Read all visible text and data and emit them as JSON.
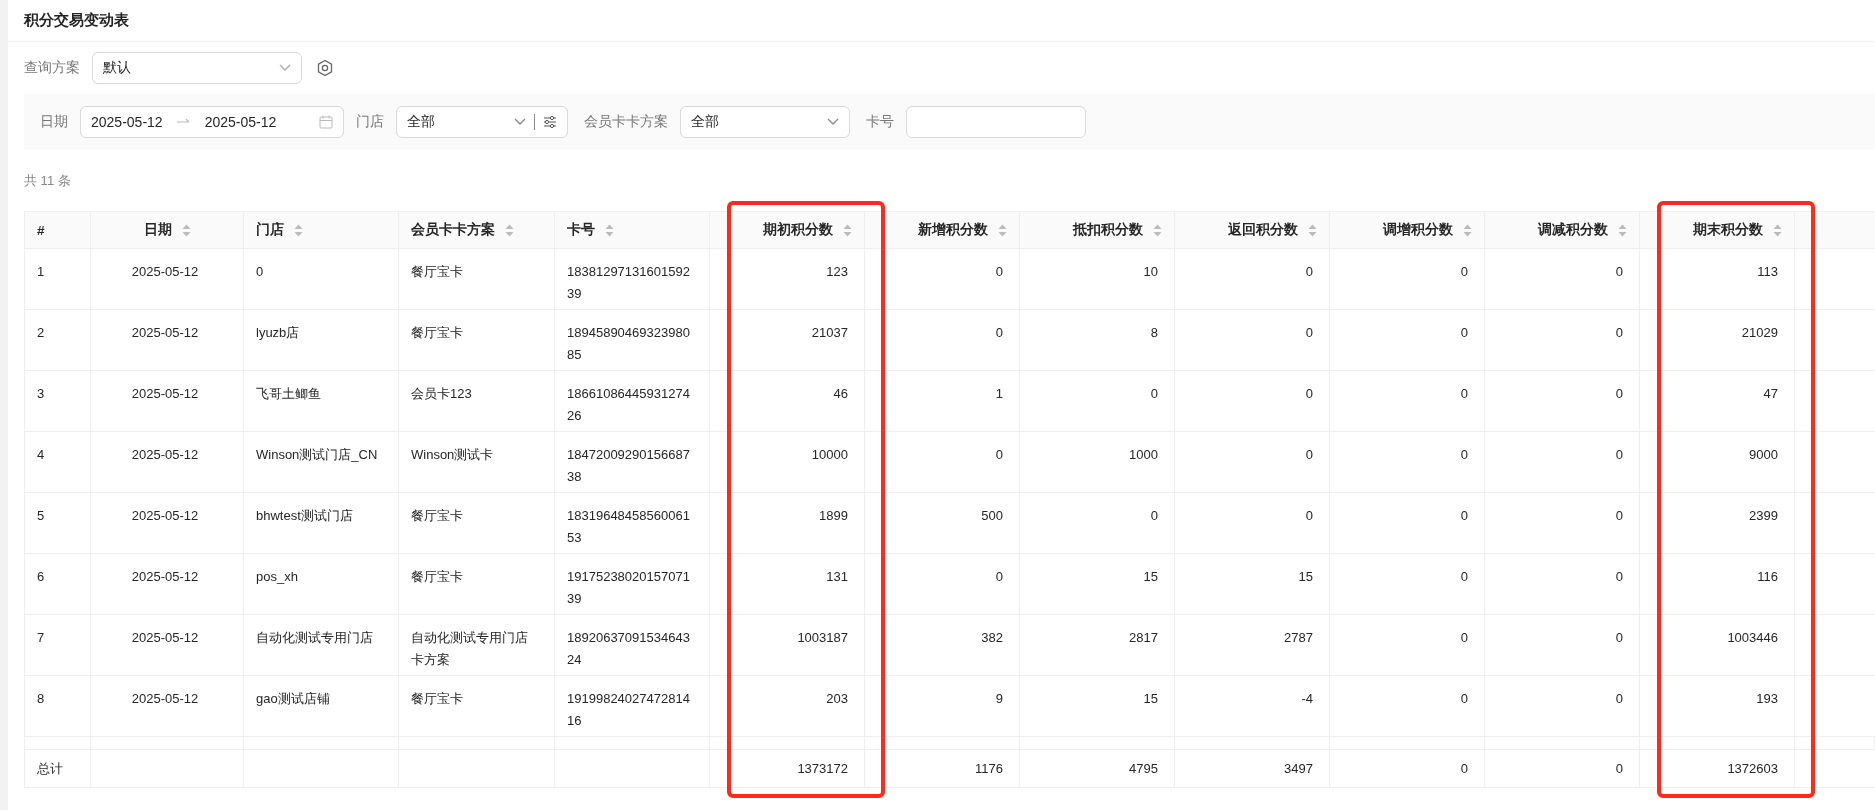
{
  "page_title": "积分交易变动表",
  "query_scheme": {
    "label": "查询方案",
    "value": "默认"
  },
  "filters": {
    "date": {
      "label": "日期",
      "start": "2025-05-12",
      "end": "2025-05-12"
    },
    "store": {
      "label": "门店",
      "value": "全部"
    },
    "card_scheme": {
      "label": "会员卡卡方案",
      "value": "全部"
    },
    "card_no": {
      "label": "卡号"
    }
  },
  "total_count": "共 11 条",
  "table": {
    "columns": [
      {
        "label": "#",
        "kind": "index",
        "sortable": false,
        "highlighted": false
      },
      {
        "label": "日期",
        "kind": "date",
        "sortable": true,
        "highlighted": false
      },
      {
        "label": "门店",
        "kind": "text",
        "sortable": true,
        "highlighted": false
      },
      {
        "label": "会员卡卡方案",
        "kind": "text",
        "sortable": true,
        "highlighted": false
      },
      {
        "label": "卡号",
        "kind": "text",
        "sortable": true,
        "highlighted": false
      },
      {
        "label": "期初积分数",
        "kind": "number",
        "sortable": true,
        "highlighted": true
      },
      {
        "label": "新增积分数",
        "kind": "number",
        "sortable": true,
        "highlighted": false
      },
      {
        "label": "抵扣积分数",
        "kind": "number",
        "sortable": true,
        "highlighted": false
      },
      {
        "label": "返回积分数",
        "kind": "number",
        "sortable": true,
        "highlighted": false
      },
      {
        "label": "调增积分数",
        "kind": "number",
        "sortable": true,
        "highlighted": false
      },
      {
        "label": "调减积分数",
        "kind": "number",
        "sortable": true,
        "highlighted": false
      },
      {
        "label": "期末积分数",
        "kind": "number",
        "sortable": true,
        "highlighted": true
      }
    ],
    "rows": [
      [
        "1",
        "2025-05-12",
        "0",
        "餐厅宝卡",
        "1838129713160159239",
        "123",
        "0",
        "10",
        "0",
        "0",
        "0",
        "113"
      ],
      [
        "2",
        "2025-05-12",
        "lyuzb店",
        "餐厅宝卡",
        "1894589046932398085",
        "21037",
        "0",
        "8",
        "0",
        "0",
        "0",
        "21029"
      ],
      [
        "3",
        "2025-05-12",
        "飞哥土鲫鱼",
        "会员卡123",
        "1866108644593127426",
        "46",
        "1",
        "0",
        "0",
        "0",
        "0",
        "47"
      ],
      [
        "4",
        "2025-05-12",
        "Winson测试门店_CN",
        "Winson测试卡",
        "1847200929015668738",
        "10000",
        "0",
        "1000",
        "0",
        "0",
        "0",
        "9000"
      ],
      [
        "5",
        "2025-05-12",
        "bhwtest测试门店",
        "餐厅宝卡",
        "1831964845856006153",
        "1899",
        "500",
        "0",
        "0",
        "0",
        "0",
        "2399"
      ],
      [
        "6",
        "2025-05-12",
        "pos_xh",
        "餐厅宝卡",
        "1917523802015707139",
        "131",
        "0",
        "15",
        "15",
        "0",
        "0",
        "116"
      ],
      [
        "7",
        "2025-05-12",
        "自动化测试专用门店",
        "自动化测试专用门店卡方案",
        "1892063709153464324",
        "1003187",
        "382",
        "2817",
        "2787",
        "0",
        "0",
        "1003446"
      ],
      [
        "8",
        "2025-05-12",
        "gao测试店铺",
        "餐厅宝卡",
        "1919982402747281416",
        "203",
        "9",
        "15",
        "-4",
        "0",
        "0",
        "193"
      ]
    ],
    "summary": {
      "label": "总计",
      "totals": [
        "1373172",
        "1176",
        "4795",
        "3497",
        "0",
        "0",
        "1372603"
      ]
    }
  }
}
